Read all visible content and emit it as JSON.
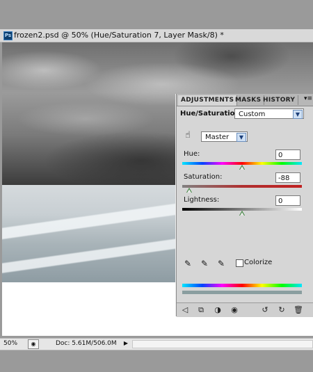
{
  "document": {
    "ps_badge": "Ps",
    "title": "frozen2.psd @ 50% (Hue/Saturation 7, Layer Mask/8) *"
  },
  "status": {
    "zoom": "50%",
    "doc_info": "Doc: 5.61M/506.0M"
  },
  "adjustments": {
    "tabs": [
      "ADJUSTMENTS",
      "MASKS",
      "HISTORY"
    ],
    "active_tab": "ADJUSTMENTS",
    "preset_label": "Hue/Saturation",
    "preset_value": "Custom",
    "channel_value": "Master",
    "hue": {
      "label": "Hue:",
      "value": "0"
    },
    "saturation": {
      "label": "Saturation:",
      "value": "-88"
    },
    "lightness": {
      "label": "Lightness:",
      "value": "0"
    },
    "colorize_label": "Colorize",
    "colorize_checked": false
  },
  "icons": {
    "panel_menu": "panel-menu-icon",
    "hand_tool": "targeted-adjustment-icon",
    "eyedropper": "eyedropper-icon",
    "eyedropper_plus": "eyedropper-add-icon",
    "eyedropper_minus": "eyedropper-subtract-icon",
    "back": "back-arrow-icon",
    "expand": "expand-view-icon",
    "clip": "clip-to-layer-icon",
    "visibility": "eye-icon",
    "previous_state": "previous-state-icon",
    "reset": "reset-icon",
    "delete": "trash-icon"
  },
  "colors": {
    "panel_bg": "#d6d6d6",
    "thumb": "#2c7b2c"
  }
}
